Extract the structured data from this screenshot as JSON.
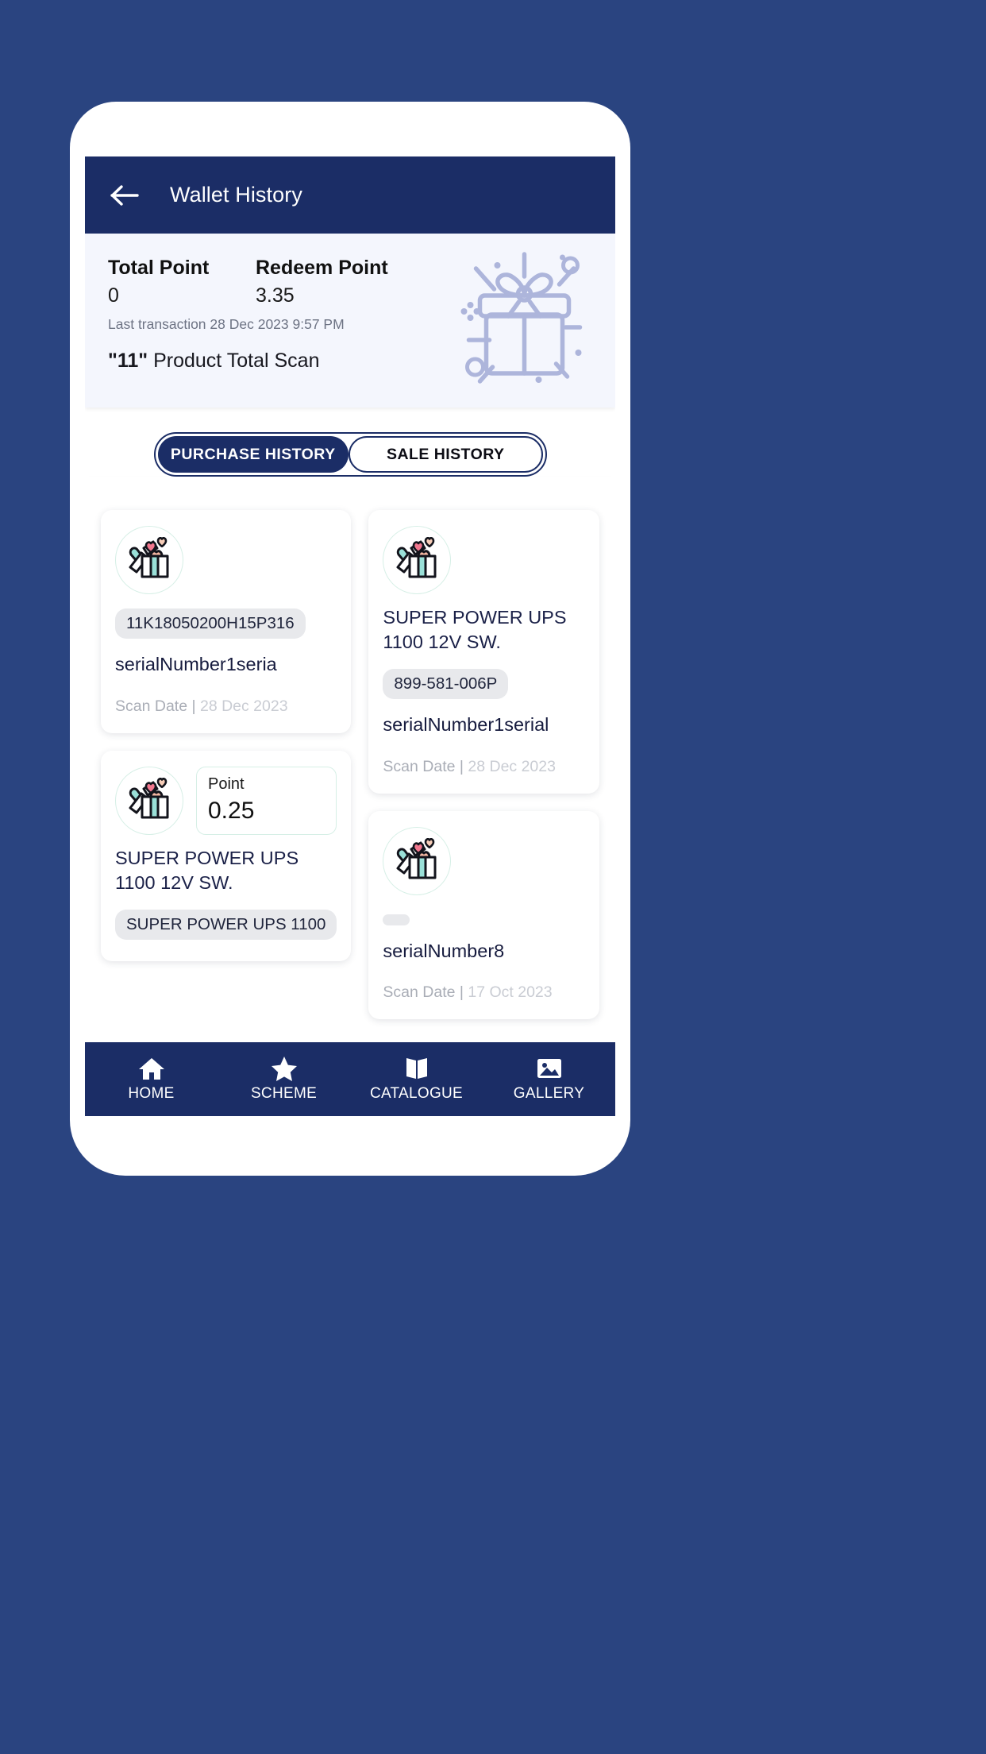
{
  "appbar": {
    "back_icon": "arrow-left-icon",
    "title": "Wallet History"
  },
  "summary": {
    "total_point_label": "Total Point",
    "total_point_value": "0",
    "redeem_point_label": "Redeem Point",
    "redeem_point_value": "3.35",
    "last_transaction": "Last transaction 28 Dec 2023 9:57 PM",
    "scan_count": "\"11\"",
    "scan_suffix": " Product Total Scan",
    "illustration_icon": "gift-box-illustration-icon"
  },
  "tabs": [
    {
      "label": "PURCHASE HISTORY",
      "active": true
    },
    {
      "label": "SALE HISTORY",
      "active": false
    }
  ],
  "cards": [
    {
      "icon": "gift-hearts-icon",
      "product_name": "",
      "badge": "11K18050200H15P316",
      "serial": "serialNumber1seria",
      "scan_date_label": "Scan Date |",
      "scan_date_value": "28 Dec 2023",
      "point_label": "",
      "point_value": ""
    },
    {
      "icon": "gift-hearts-icon",
      "product_name": "SUPER POWER UPS 1100 12V SW.",
      "badge": "899-581-006P",
      "serial": "serialNumber1serial",
      "scan_date_label": "Scan Date |",
      "scan_date_value": "28 Dec 2023",
      "point_label": "",
      "point_value": ""
    },
    {
      "icon": "gift-hearts-icon",
      "product_name": "SUPER POWER UPS 1100 12V SW.",
      "badge": "SUPER POWER UPS 1100",
      "serial": "",
      "scan_date_label": "",
      "scan_date_value": "",
      "point_label": "Point",
      "point_value": "0.25"
    },
    {
      "icon": "gift-hearts-icon",
      "product_name": "",
      "badge": "",
      "serial": "serialNumber8",
      "scan_date_label": "Scan Date |",
      "scan_date_value": "17 Oct 2023",
      "point_label": "",
      "point_value": ""
    }
  ],
  "bottom_nav": [
    {
      "label": "HOME",
      "icon": "home-icon"
    },
    {
      "label": "SCHEME",
      "icon": "star-icon"
    },
    {
      "label": "CATALOGUE",
      "icon": "book-icon"
    },
    {
      "label": "GALLERY",
      "icon": "image-icon"
    }
  ],
  "colors": {
    "brand_navy": "#1b2d66",
    "page_bg": "#2a4480",
    "summary_bg": "#f4f6fd",
    "badge_bg": "#e8e9ec"
  }
}
